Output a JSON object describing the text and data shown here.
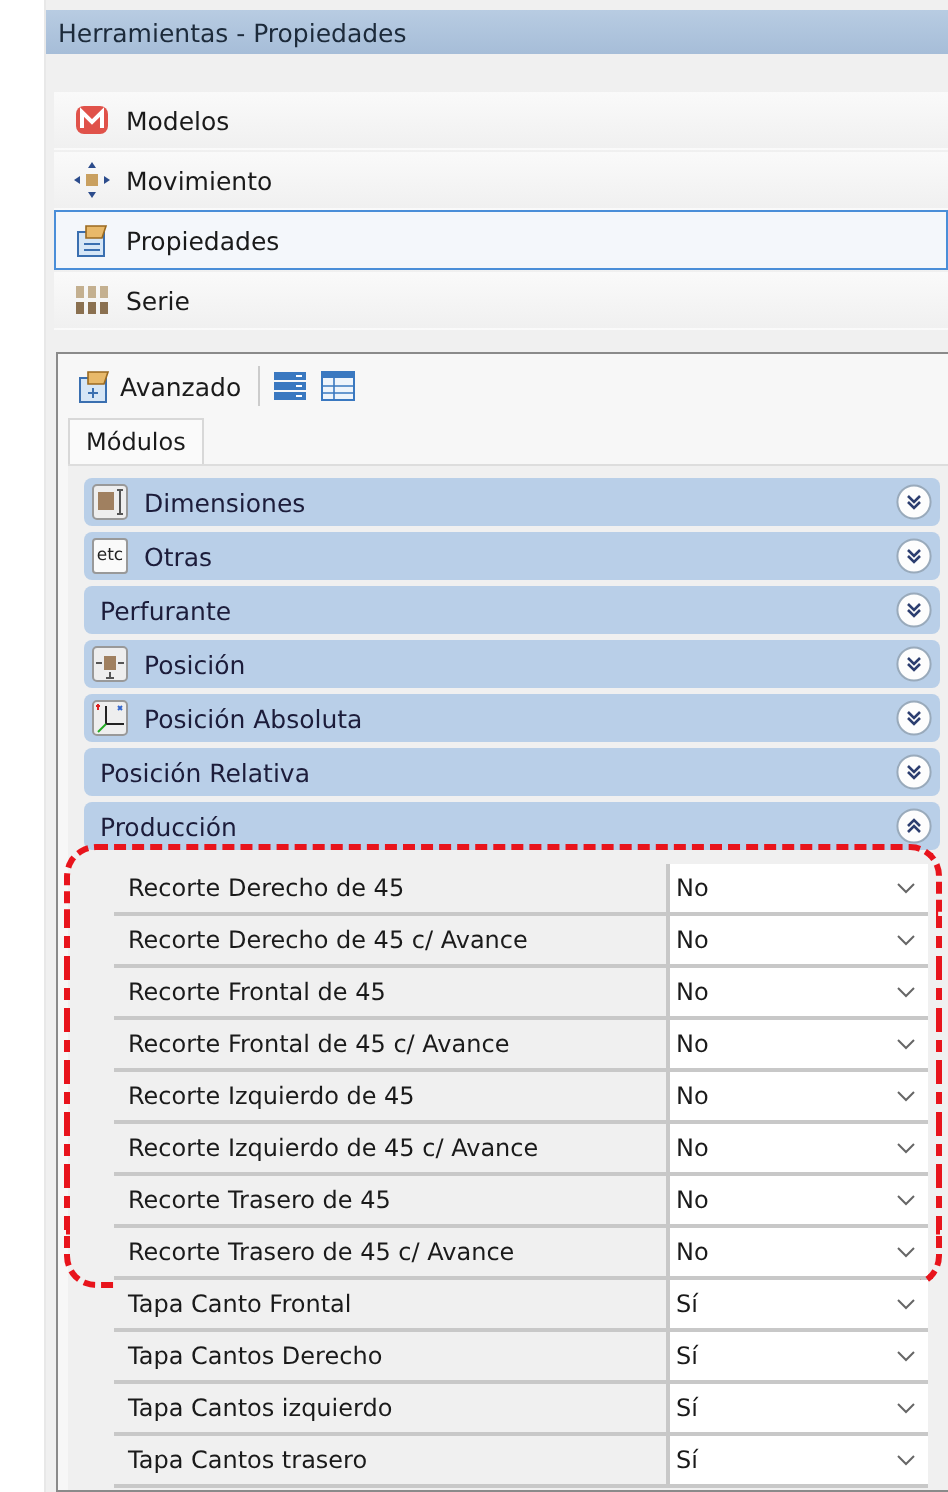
{
  "window": {
    "title": "Herramientas - Propiedades"
  },
  "nav_items": [
    {
      "label": "Modelos",
      "selected": false
    },
    {
      "label": "Movimiento",
      "selected": false
    },
    {
      "label": "Propiedades",
      "selected": true
    },
    {
      "label": "Serie",
      "selected": false
    }
  ],
  "toolbar": {
    "label": "Avanzado"
  },
  "tabs": [
    {
      "label": "Módulos",
      "selected": true
    }
  ],
  "sections": [
    {
      "label": "Dimensiones",
      "expanded": false
    },
    {
      "label": "Otras",
      "icon_text": "etc",
      "expanded": false
    },
    {
      "label": "Perfurante",
      "expanded": false
    },
    {
      "label": "Posición",
      "expanded": false
    },
    {
      "label": "Posición Absoluta",
      "expanded": false
    },
    {
      "label": "Posición Relativa",
      "expanded": false
    },
    {
      "label": "Producción",
      "expanded": true
    }
  ],
  "properties": [
    {
      "name": "Recorte Derecho de 45",
      "value": "No",
      "highlighted": true
    },
    {
      "name": "Recorte Derecho de 45 c/ Avance",
      "value": "No",
      "highlighted": true
    },
    {
      "name": "Recorte Frontal de 45",
      "value": "No",
      "highlighted": true
    },
    {
      "name": "Recorte Frontal de 45 c/ Avance",
      "value": "No",
      "highlighted": true
    },
    {
      "name": "Recorte Izquierdo de 45",
      "value": "No",
      "highlighted": true
    },
    {
      "name": "Recorte Izquierdo de 45 c/ Avance",
      "value": "No",
      "highlighted": true
    },
    {
      "name": "Recorte Trasero de 45",
      "value": "No",
      "highlighted": true
    },
    {
      "name": "Recorte Trasero de 45 c/ Avance",
      "value": "No",
      "highlighted": true
    },
    {
      "name": "Tapa Canto Frontal",
      "value": "Sí",
      "highlighted": false
    },
    {
      "name": "Tapa Cantos Derecho",
      "value": "Sí",
      "highlighted": false
    },
    {
      "name": "Tapa Cantos izquierdo",
      "value": "Sí",
      "highlighted": false
    },
    {
      "name": "Tapa Cantos trasero",
      "value": "Sí",
      "highlighted": false
    }
  ]
}
